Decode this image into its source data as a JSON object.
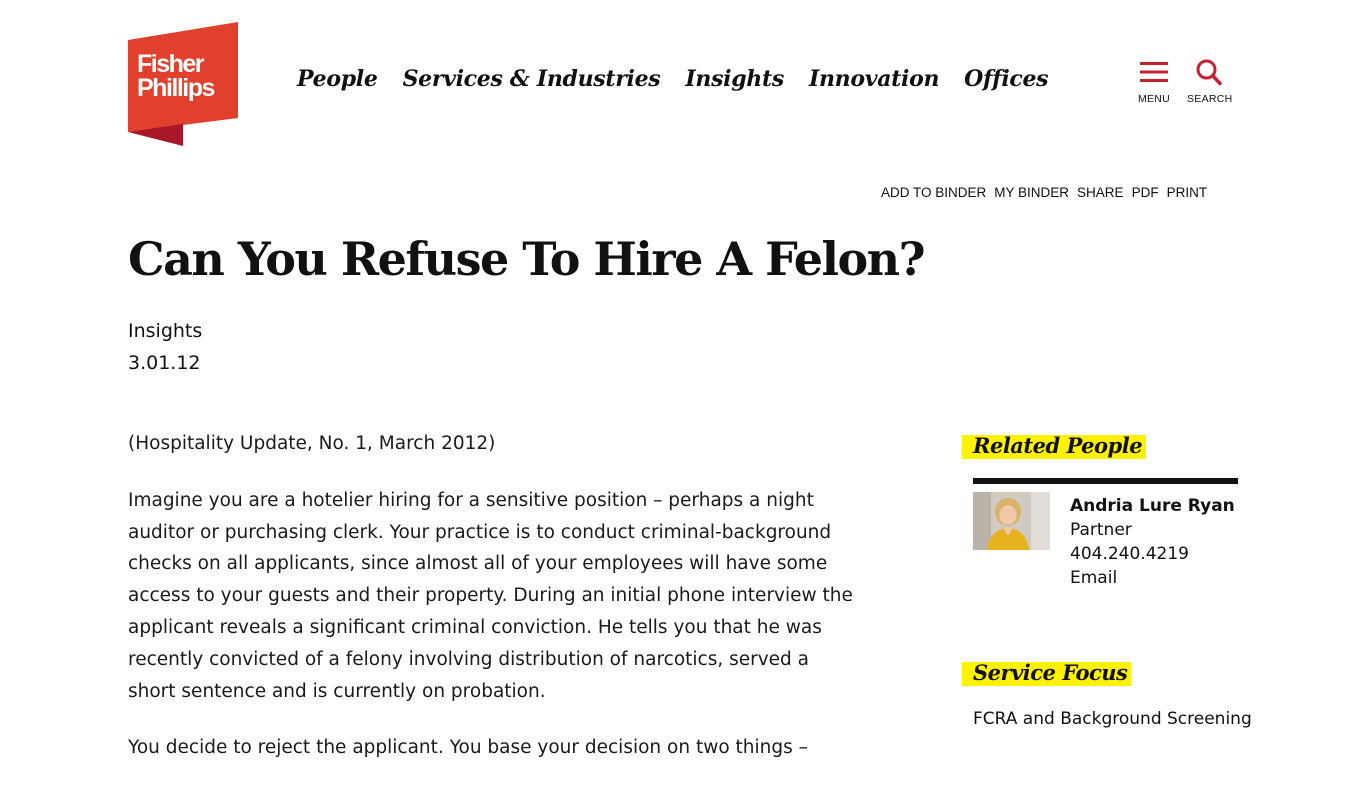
{
  "brand": {
    "logo_line1": "Fisher",
    "logo_line2": "Phillips",
    "color": "#e0402c"
  },
  "nav": {
    "items": [
      "People",
      "Services & Industries",
      "Insights",
      "Innovation",
      "Offices"
    ]
  },
  "header_buttons": {
    "menu_label": "MENU",
    "search_label": "SEARCH",
    "icon_color": "#c8202f"
  },
  "toolbar": {
    "add_to_binder": "ADD TO BINDER",
    "my_binder": "MY BINDER",
    "share": "SHARE",
    "pdf": "PDF",
    "print": "PRINT"
  },
  "article": {
    "title": "Can You Refuse To Hire A Felon?",
    "category": "Insights",
    "date": "3.01.12",
    "paragraphs": [
      "(Hospitality Update, No. 1, March 2012)",
      "Imagine you are a hotelier hiring for a sensitive position – perhaps a night auditor or purchasing clerk. Your practice is to conduct criminal-background checks on all applicants, since almost all of your employees will have some access to your guests and their property. During an initial phone interview the applicant reveals a significant criminal conviction. He tells you that he was recently convicted of a felony involving distribution of narcotics, served a short sentence and is currently on probation.",
      "You decide to reject the applicant. You base your decision on two things –"
    ]
  },
  "sidebar": {
    "related_people_heading": "Related People",
    "person": {
      "name": "Andria Lure Ryan",
      "title": "Partner",
      "phone": "404.240.4219",
      "email_label": "Email"
    },
    "service_focus_heading": "Service Focus",
    "service_focus_item": "FCRA and Background Screening",
    "highlight_color": "#fff200"
  }
}
